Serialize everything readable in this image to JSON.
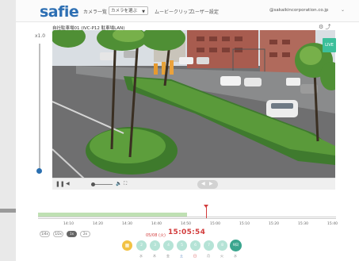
{
  "header": {
    "logo": "safie",
    "camera_list_label": "カメラ一覧",
    "camera_select": "カメラを選ぶ",
    "nav": [
      "ムービークリップ",
      "ユーザー設定"
    ],
    "user_email": "@sakaikincorporation.co.jp"
  },
  "camera": {
    "title": "自社駐車場01 (IVC-P12 駐車場LAN)",
    "zoom_level": "x1.0",
    "zoom_fraction": 0.0,
    "live_label": "LIVE"
  },
  "player": {
    "play_icon": "pause",
    "rewind_icon": "rewind",
    "volume_fraction": 0.0
  },
  "timeline": {
    "ticks": [
      "14:10",
      "14:20",
      "14:30",
      "14:40",
      "14:50",
      "15:00",
      "15:10",
      "15:20",
      "15:30",
      "15:40"
    ],
    "recorded_until_fraction": 0.5,
    "playhead_fraction": 0.565
  },
  "speeds": [
    {
      "label": "1/4x",
      "active": false
    },
    {
      "label": "1/2x",
      "active": false
    },
    {
      "label": "1x",
      "active": true
    },
    {
      "label": "2x",
      "active": false
    }
  ],
  "datetime": {
    "date": "05/08 (火)",
    "time": "15:05:54"
  },
  "days": [
    {
      "day": "2",
      "weekday": "水",
      "active": false
    },
    {
      "day": "3",
      "weekday": "木",
      "active": false
    },
    {
      "day": "4",
      "weekday": "金",
      "active": false
    },
    {
      "day": "5",
      "weekday": "土",
      "active": false
    },
    {
      "day": "6",
      "weekday": "日",
      "active": false
    },
    {
      "day": "7",
      "weekday": "月",
      "active": false
    },
    {
      "day": "8",
      "weekday": "火",
      "active": false
    },
    {
      "day": "9日",
      "weekday": "水",
      "active": true
    }
  ],
  "colors": {
    "brand_blue": "#2d6fb3",
    "live_green": "#3cbf9b",
    "clock_red": "#d23b3b",
    "chip_active": "#3aa58e",
    "chip": "#b5e3d6"
  }
}
